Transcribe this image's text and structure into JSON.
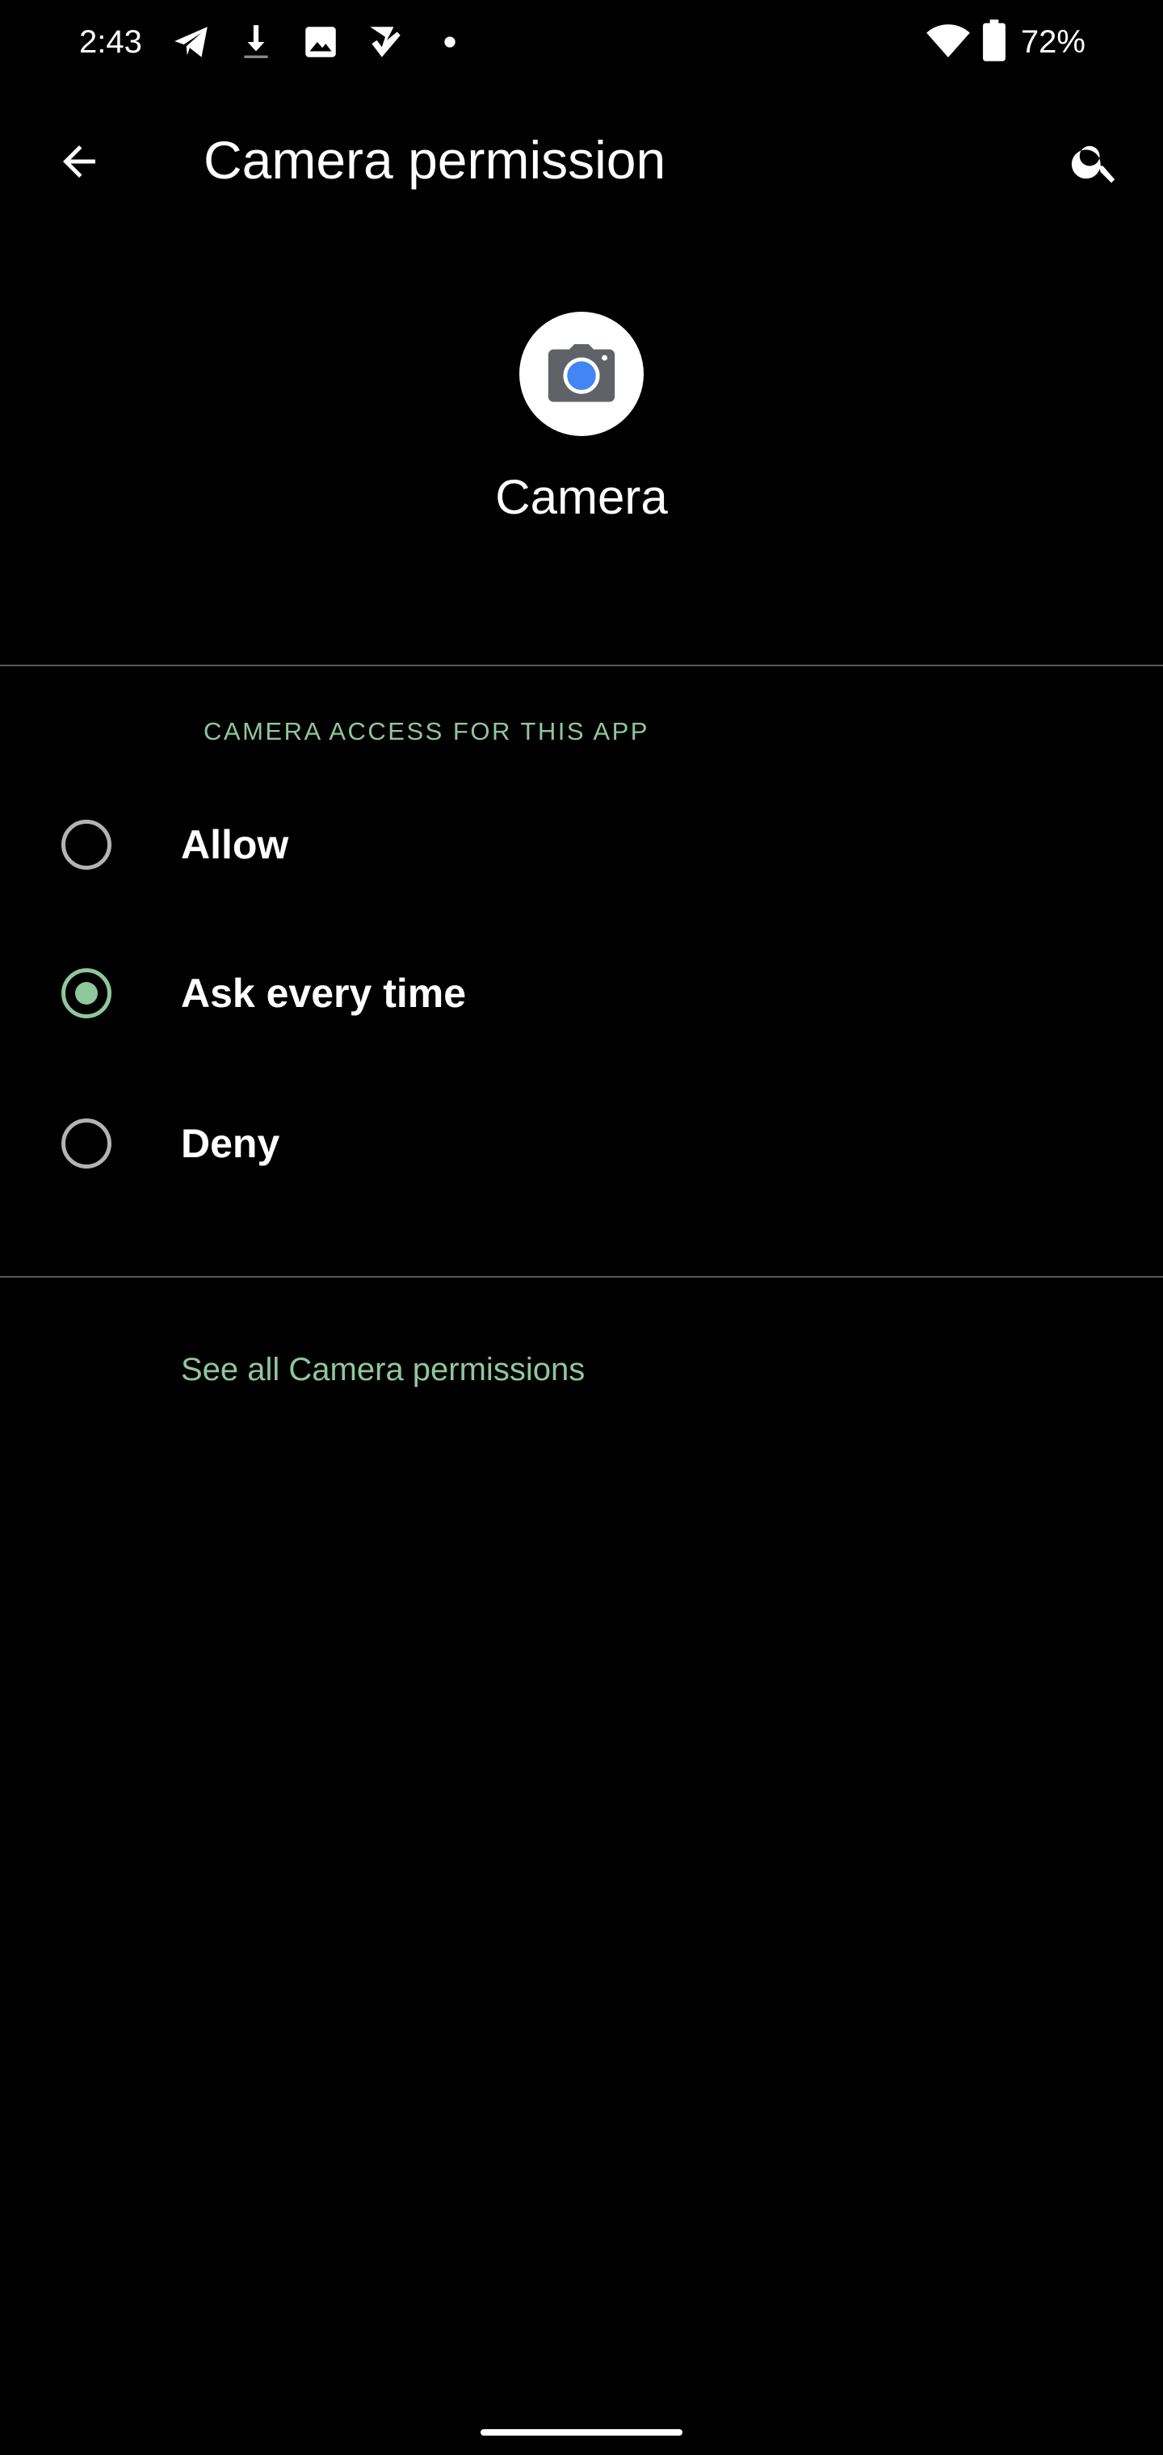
{
  "status_bar": {
    "time": "2:43",
    "battery": "72%",
    "icons_left": [
      "telegram-icon",
      "download-icon",
      "image-icon",
      "tasks-check-icon",
      "dot-icon"
    ],
    "icons_right": [
      "wifi-icon",
      "battery-icon"
    ]
  },
  "app_bar": {
    "title": "Camera permission",
    "back_icon": "arrow-back-icon",
    "search_icon": "search-icon"
  },
  "app": {
    "name": "Camera",
    "icon": "camera-app-icon"
  },
  "permissions": {
    "section_header": "CAMERA ACCESS FOR THIS APP",
    "options": [
      {
        "label": "Allow",
        "selected": false
      },
      {
        "label": "Ask every time",
        "selected": true
      },
      {
        "label": "Deny",
        "selected": false
      }
    ],
    "see_all_link": "See all Camera permissions"
  },
  "colors": {
    "background": "#000000",
    "accent": "#8fc79a",
    "text": "#ffffff",
    "divider": "#5a5a5a",
    "radio_unchecked": "#b3b3b3"
  }
}
